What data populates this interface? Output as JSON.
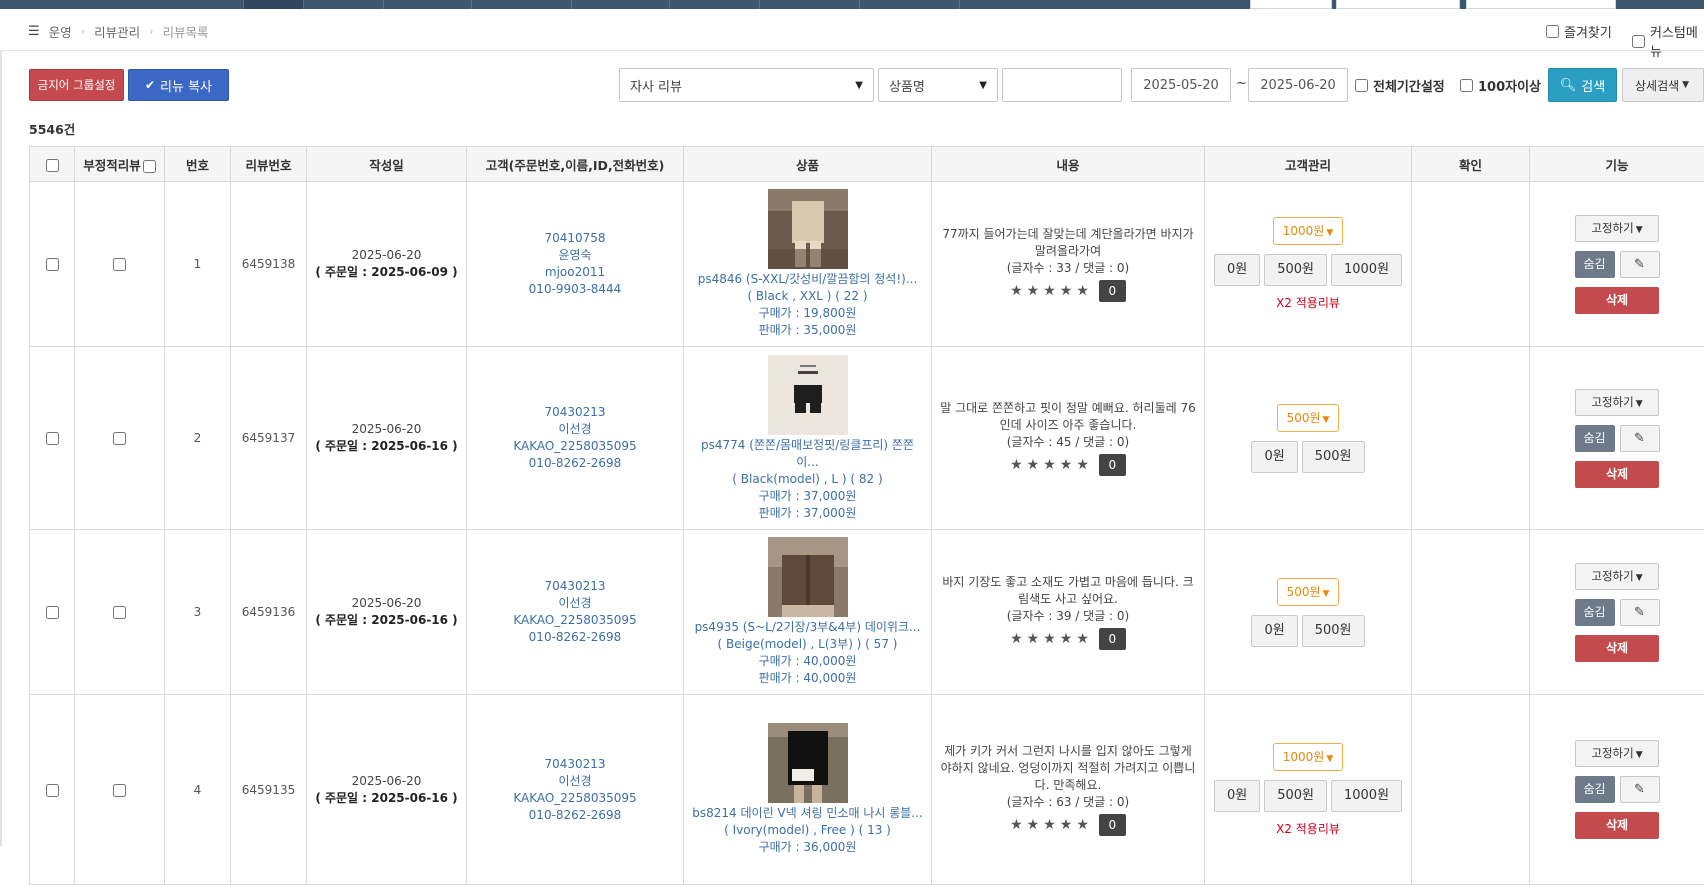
{
  "breadcrumb": {
    "items": [
      "운영",
      "리뷰관리"
    ],
    "current": "리뷰목록"
  },
  "header_right": {
    "favorites": "즐겨찾기",
    "custom_menu": "커스텀메뉴"
  },
  "toolbar": {
    "ban_group_button": "금지어 그룹설정",
    "copy_button": "리뉴 복사",
    "review_type": "자사 리뷰",
    "search_field": "상품명",
    "search_text": "",
    "date_from": "2025-05-20",
    "date_sep": "~",
    "date_to": "2025-06-20",
    "all_period": "전체기간설정",
    "over100": "100자이상",
    "search_button": "검색",
    "detail_button": "상세검색"
  },
  "count_label": "5546건",
  "table": {
    "headers": [
      "부정적리뷰",
      "번호",
      "리뷰번호",
      "작성일",
      "고객(주문번호,이름,ID,전화번호)",
      "상품",
      "내용",
      "고객관리",
      "확인",
      "기능"
    ],
    "rows": [
      {
        "num": "1",
        "review_no": "6459138",
        "date": "2025-06-20",
        "order_date": "( 주문일 : 2025-06-09 )",
        "order_no": "70410758",
        "name": "윤영숙",
        "user_id": "mjoo2011",
        "phone": "010-9903-8444",
        "product": "ps4846 (S-XXL/갓성비/깔끔함의 정석!)...",
        "option": "( Black , XXL ) ( 22 )",
        "buy_price": "구매가 : 19,800원",
        "sell_price": "판매가 : 35,000원",
        "content": "77까지 들어가는데 잘맞는데 계단올라가면 바지가 말려올라가여",
        "counts": "(글자수 : 33 / 댓글 : 0)",
        "stars": "★★★★★",
        "reply": "0",
        "point_dd": "1000원",
        "points": [
          "0원",
          "500원",
          "1000원"
        ],
        "x2": "X2 적용리뷰",
        "fix": "고정하기",
        "hide": "숨김",
        "delete": "삭제"
      },
      {
        "num": "2",
        "review_no": "6459137",
        "date": "2025-06-20",
        "order_date": "( 주문일 : 2025-06-16 )",
        "order_no": "70430213",
        "name": "이선경",
        "user_id": "KAKAO_2258035095",
        "phone": "010-8262-2698",
        "product": "ps4774 (쫀쫀/몸매보정핏/링클프리) 쫀쫀이...",
        "option": "( Black(model) , L ) ( 82 )",
        "buy_price": "구매가 : 37,000원",
        "sell_price": "판매가 : 37,000원",
        "content": "말 그대로 쫀쫀하고 핏이 정말 예뻐요. 허리둘레 76 인데 사이즈 아주 좋습니다.",
        "counts": "(글자수 : 45 / 댓글 : 0)",
        "stars": "★★★★★",
        "reply": "0",
        "point_dd": "500원",
        "points": [
          "0원",
          "500원"
        ],
        "x2": "",
        "fix": "고정하기",
        "hide": "숨김",
        "delete": "삭제"
      },
      {
        "num": "3",
        "review_no": "6459136",
        "date": "2025-06-20",
        "order_date": "( 주문일 : 2025-06-16 )",
        "order_no": "70430213",
        "name": "이선경",
        "user_id": "KAKAO_2258035095",
        "phone": "010-8262-2698",
        "product": "ps4935 (S~L/2기장/3부&4부) 데이위크...",
        "option": "( Beige(model) , L(3부) ) ( 57 )",
        "buy_price": "구매가 : 40,000원",
        "sell_price": "판매가 : 40,000원",
        "content": "바지 기장도 좋고 소재도 가볍고 마음에 듭니다. 크림색도 사고 싶어요.",
        "counts": "(글자수 : 39 / 댓글 : 0)",
        "stars": "★★★★★",
        "reply": "0",
        "point_dd": "500원",
        "points": [
          "0원",
          "500원"
        ],
        "x2": "",
        "fix": "고정하기",
        "hide": "숨김",
        "delete": "삭제"
      },
      {
        "num": "4",
        "review_no": "6459135",
        "date": "2025-06-20",
        "order_date": "( 주문일 : 2025-06-16 )",
        "order_no": "70430213",
        "name": "이선경",
        "user_id": "KAKAO_2258035095",
        "phone": "010-8262-2698",
        "product": "bs8214 데이린 V넥 셔링 민소매 나시 롱블...",
        "option": "( Ivory(model) , Free ) ( 13 )",
        "buy_price": "구매가 : 36,000원",
        "sell_price": "",
        "content": "제가 키가 커서 그런지 나시를 입지 않아도 그렇게 야하지 않네요. 엉덩이까지 적절히 가려지고 이쁩니다. 만족해요.",
        "counts": "(글자수 : 63 / 댓글 : 0)",
        "stars": "★★★★★",
        "reply": "0",
        "point_dd": "1000원",
        "points": [
          "0원",
          "500원",
          "1000원"
        ],
        "x2": "X2 적용리뷰",
        "fix": "고정하기",
        "hide": "숨김",
        "delete": "삭제"
      }
    ]
  }
}
